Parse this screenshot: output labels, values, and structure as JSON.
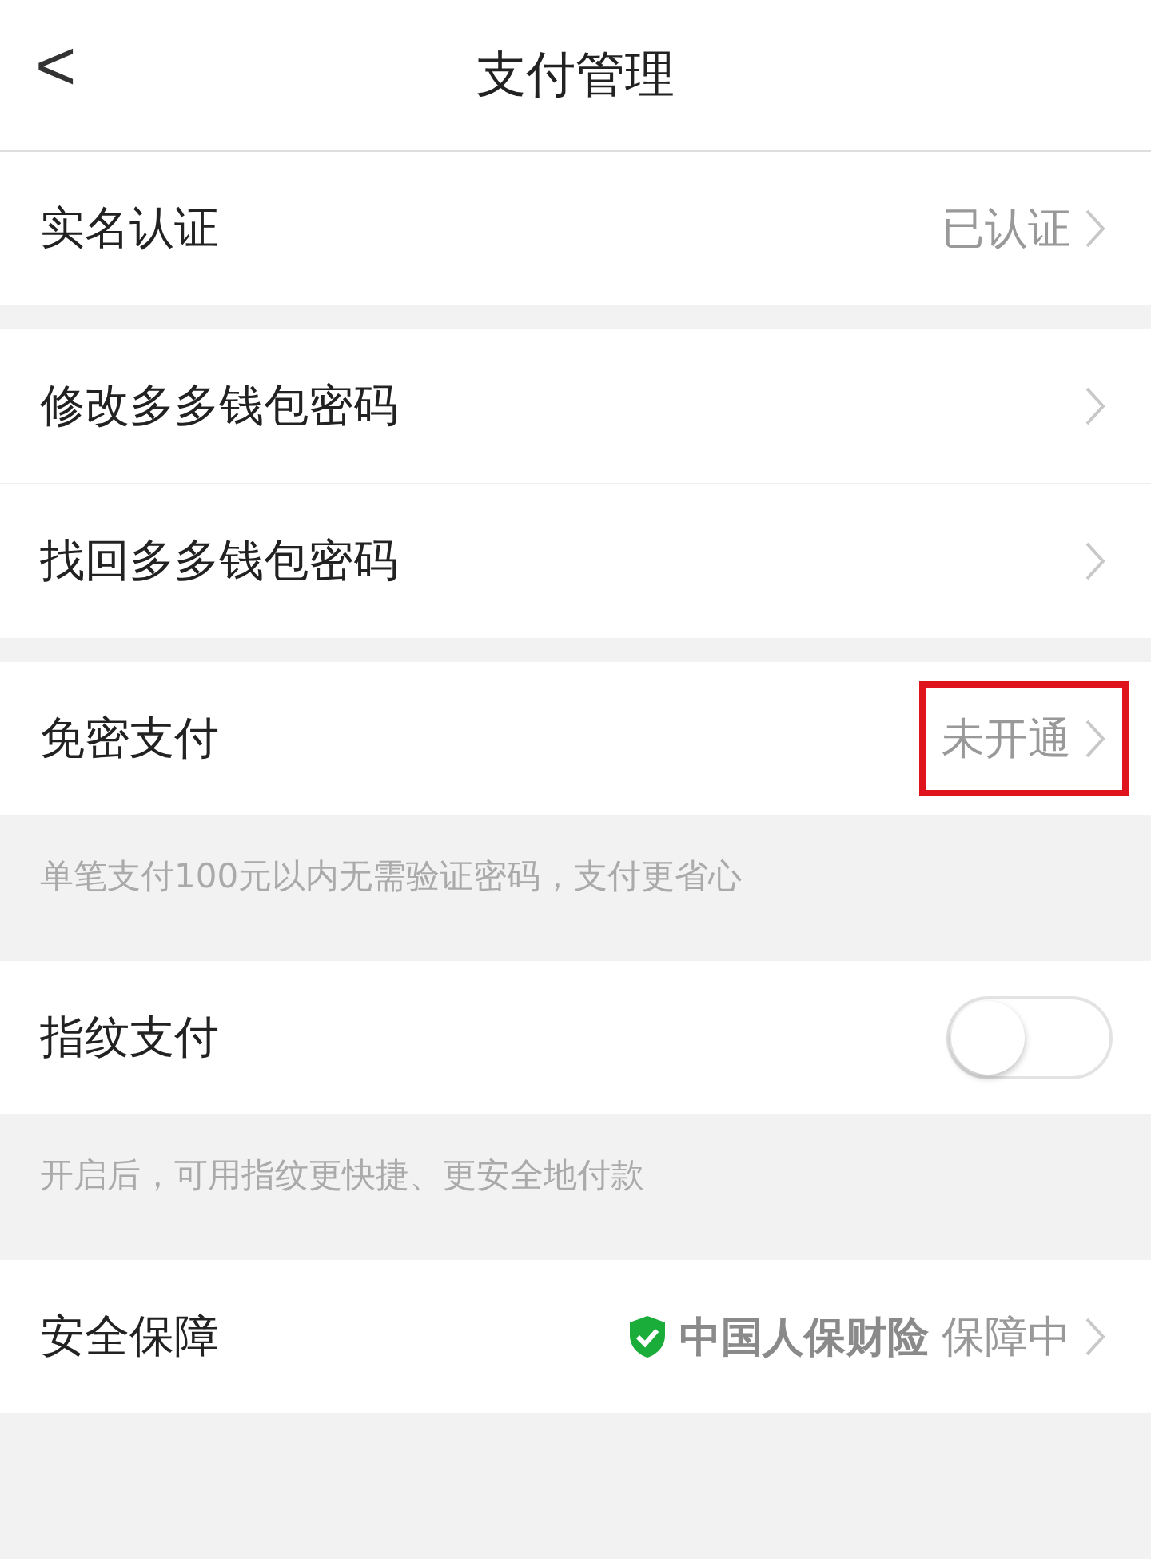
{
  "header": {
    "back": "<",
    "title": "支付管理"
  },
  "groups": [
    {
      "rows": [
        {
          "kind": "link",
          "label": "实名认证",
          "value": "已认证",
          "highlighted": false
        }
      ]
    },
    {
      "rows": [
        {
          "kind": "link",
          "label": "修改多多钱包密码",
          "highlighted": false
        },
        {
          "kind": "link",
          "label": "找回多多钱包密码",
          "highlighted": false
        }
      ]
    },
    {
      "rows": [
        {
          "kind": "link",
          "label": "免密支付",
          "value": "未开通",
          "highlighted": true
        }
      ],
      "note": "单笔支付100元以内无需验证密码，支付更省心"
    },
    {
      "rows": [
        {
          "kind": "toggle",
          "label": "指纹支付",
          "on": false
        }
      ],
      "note": "开启后，可用指纹更快捷、更安全地付款"
    },
    {
      "rows": [
        {
          "kind": "insurance",
          "label": "安全保障",
          "brand": "中国人保财险",
          "value": "保障中",
          "highlighted": false
        }
      ]
    }
  ]
}
